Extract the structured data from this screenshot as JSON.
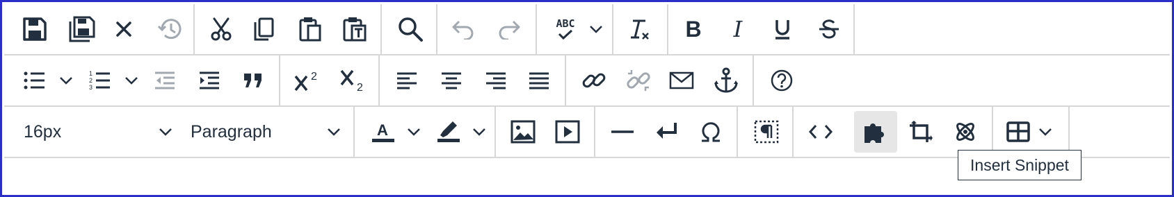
{
  "toolbar": {
    "font_size": {
      "value": "16px"
    },
    "block_format": {
      "value": "Paragraph"
    },
    "spellcheck_icon_text": "ABC",
    "tooltip": "Insert Snippet"
  },
  "icons": [
    "save-icon",
    "save-all-icon",
    "close-icon",
    "restore-draft-icon",
    "cut-icon",
    "copy-icon",
    "paste-icon",
    "paste-as-text-icon",
    "search-replace-icon",
    "undo-icon",
    "redo-icon",
    "spellcheck-icon",
    "remove-format-icon",
    "bold-icon",
    "italic-icon",
    "underline-icon",
    "strikethrough-icon",
    "bullet-list-icon",
    "numbered-list-icon",
    "outdent-icon",
    "indent-icon",
    "blockquote-icon",
    "superscript-icon",
    "subscript-icon",
    "align-left-icon",
    "align-center-icon",
    "align-right-icon",
    "justify-icon",
    "link-icon",
    "unlink-icon",
    "email-icon",
    "anchor-icon",
    "help-icon",
    "text-color-icon",
    "highlight-color-icon",
    "image-icon",
    "media-icon",
    "horizontal-rule-icon",
    "line-break-icon",
    "special-character-icon",
    "visual-blocks-icon",
    "source-code-icon",
    "snippet-icon",
    "template-icon",
    "equation-icon",
    "table-icon"
  ],
  "colors": {
    "icon": "#222f3e",
    "disabled_icon": "#a2a8b0",
    "separator": "#d7d7d7",
    "border": "#2b2fc7",
    "active_bg": "#e6e6e6"
  }
}
